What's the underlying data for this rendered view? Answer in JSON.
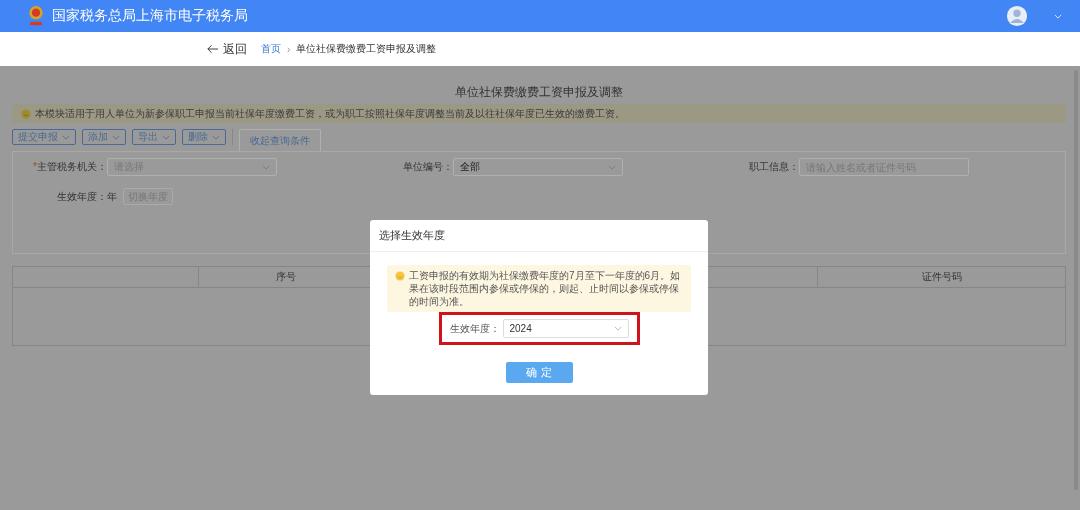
{
  "header": {
    "title": "国家税务总局上海市电子税务局"
  },
  "breadcrumb": {
    "back": "返回",
    "separator": "›",
    "items": [
      {
        "label": "首页",
        "link": true
      },
      {
        "label": "单位社保费缴费工资申报及调整",
        "link": false
      }
    ]
  },
  "page_title": "单位社保费缴费工资申报及调整",
  "notice": "本模块适用于用人单位为新参保职工申报当前社保年度缴费工资，或为职工按照社保年度调整当前及以往社保年度已生效的缴费工资。",
  "toolbar": {
    "buttons": [
      "提交申报",
      "添加",
      "导出",
      "删除"
    ],
    "toggle": "收起查询条件"
  },
  "filters": [
    {
      "kind": "select",
      "label": "主管税务机关：",
      "required_mark": "*",
      "placeholder": "请选择"
    },
    {
      "kind": "select",
      "label": "单位编号：",
      "value": "全部"
    },
    {
      "kind": "input",
      "label": "职工信息：",
      "placeholder": "请输入姓名或者证件号码"
    },
    {
      "kind": "year",
      "label": "生效年度：",
      "value": "年",
      "button": "切换年度"
    }
  ],
  "table": {
    "columns": [
      {
        "label": "序号"
      },
      {
        "label": "证件号码"
      }
    ]
  },
  "dialog": {
    "title": "选择生效年度",
    "notice": "工资申报的有效期为社保缴费年度的7月至下一年度的6月。如果在该时段范围内参保或停保的，则起、止时间以参保或停保的时间为准。",
    "field": {
      "label": "生效年度：",
      "value": "2024",
      "highlighted": true
    },
    "confirm": "确 定"
  }
}
